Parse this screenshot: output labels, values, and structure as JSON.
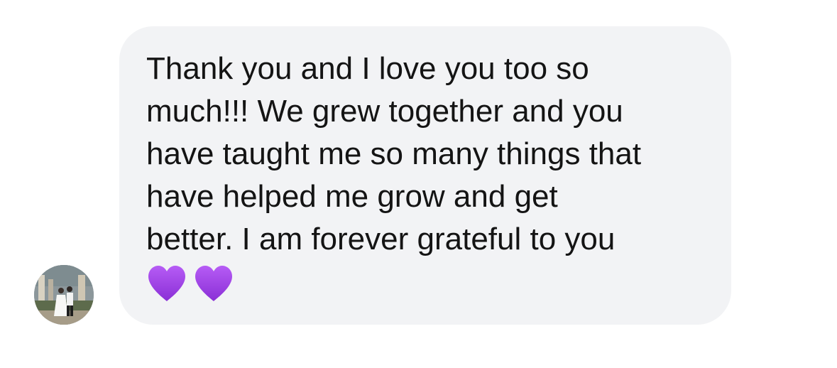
{
  "message": {
    "text": "Thank you and I love you too so\nmuch!!! We grew together and you\nhave taught me so many things that\nhave helped me grow and get\nbetter. I am forever grateful to you",
    "emojis": [
      "purple-heart",
      "purple-heart"
    ],
    "bubble_color": "#f2f3f5",
    "text_color": "#141414",
    "heart_color": "#9b3fe3"
  },
  "avatar": {
    "icon": "profile-photo-wedding-couple"
  }
}
